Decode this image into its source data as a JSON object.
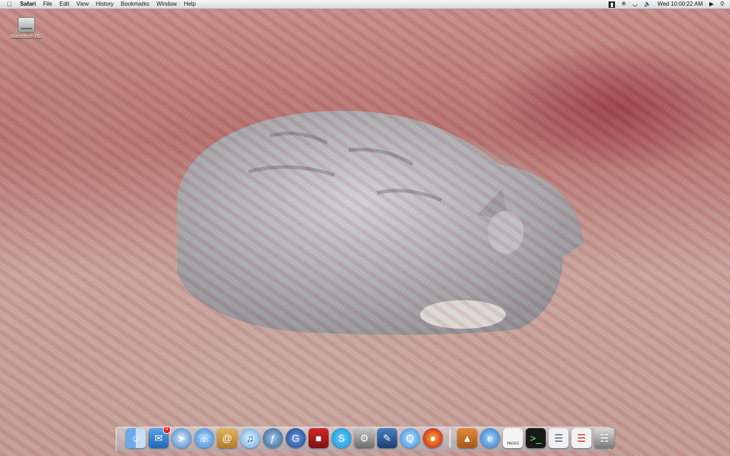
{
  "menubar": {
    "app_name": "Safari",
    "menus": [
      "File",
      "Edit",
      "View",
      "History",
      "Bookmarks",
      "Window",
      "Help"
    ],
    "clock": "Wed 10:00:22 AM"
  },
  "desktop": {
    "hd_label": "Macintosh HD"
  },
  "dock": {
    "mail_badge": "8",
    "pages_label": "PAGES"
  },
  "colors": {
    "menubar": "#e6e6e6",
    "badge": "#e0201e"
  }
}
